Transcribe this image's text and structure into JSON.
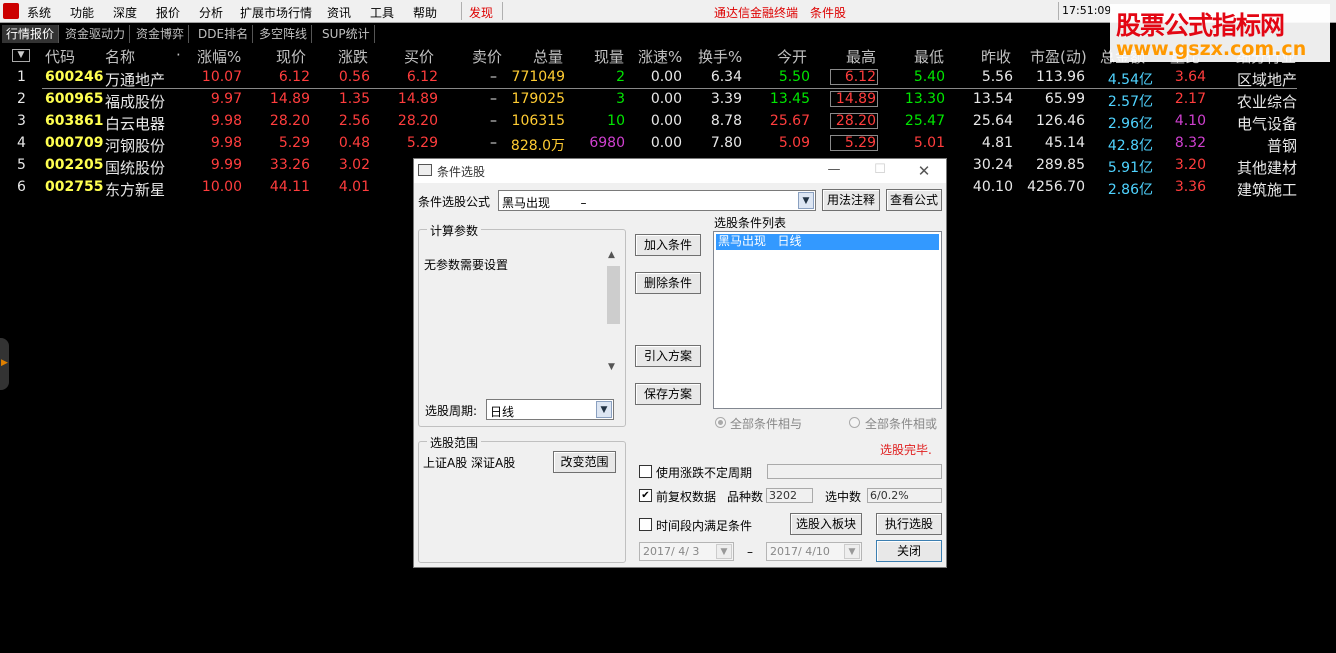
{
  "menu": {
    "items": [
      "系统",
      "功能",
      "深度",
      "报价",
      "分析",
      "扩展市场行情",
      "资讯",
      "工具",
      "帮助"
    ],
    "discover": "发现",
    "app_title": "通达信金融终端",
    "app_subtitle": "条件股",
    "clock": "17:51:09"
  },
  "watermark": {
    "line1": "股票公式指标网",
    "line2": "www.gszx.com.cn"
  },
  "tabs": [
    "行情报价",
    "资金驱动力",
    "资金博弈",
    "DDE排名",
    "多空阵线",
    "SUP统计"
  ],
  "columns": [
    "代码",
    "名称",
    "·",
    "涨幅%",
    "现价",
    "涨跌",
    "买价",
    "卖价",
    "总量",
    "现量",
    "涨速%",
    "换手%",
    "今开",
    "最高",
    "最低",
    "昨收",
    "市盈(动)",
    "总金额",
    "量比",
    "细分行业"
  ],
  "rows": [
    {
      "idx": "1",
      "code": "600246",
      "name": "万通地产",
      "chg_pct": "10.07",
      "price": "6.12",
      "chg": "0.56",
      "bid": "6.12",
      "ask": "–",
      "vol": "771049",
      "cur_vol": "2",
      "speed": "0.00",
      "turnover": "6.34",
      "open": "5.50",
      "high": "6.12",
      "low": "5.40",
      "prev": "5.56",
      "pe": "113.96",
      "amount": "4.54亿",
      "vol_ratio": "3.64",
      "industry": "区域地产"
    },
    {
      "idx": "2",
      "code": "600965",
      "name": "福成股份",
      "chg_pct": "9.97",
      "price": "14.89",
      "chg": "1.35",
      "bid": "14.89",
      "ask": "–",
      "vol": "179025",
      "cur_vol": "3",
      "speed": "0.00",
      "turnover": "3.39",
      "open": "13.45",
      "high": "14.89",
      "low": "13.30",
      "prev": "13.54",
      "pe": "65.99",
      "amount": "2.57亿",
      "vol_ratio": "2.17",
      "industry": "农业综合"
    },
    {
      "idx": "3",
      "code": "603861",
      "name": "白云电器",
      "chg_pct": "9.98",
      "price": "28.20",
      "chg": "2.56",
      "bid": "28.20",
      "ask": "–",
      "vol": "106315",
      "cur_vol": "10",
      "speed": "0.00",
      "turnover": "8.78",
      "open": "25.67",
      "high": "28.20",
      "low": "25.47",
      "prev": "25.64",
      "pe": "126.46",
      "amount": "2.96亿",
      "vol_ratio": "4.10",
      "industry": "电气设备"
    },
    {
      "idx": "4",
      "code": "000709",
      "name": "河钢股份",
      "chg_pct": "9.98",
      "price": "5.29",
      "chg": "0.48",
      "bid": "5.29",
      "ask": "–",
      "vol": "828.0万",
      "cur_vol": "6980",
      "speed": "0.00",
      "turnover": "7.80",
      "open": "5.09",
      "high": "5.29",
      "low": "5.01",
      "prev": "4.81",
      "pe": "45.14",
      "amount": "42.8亿",
      "vol_ratio": "8.32",
      "industry": "普钢"
    },
    {
      "idx": "5",
      "code": "002205",
      "name": "国统股份",
      "chg_pct": "9.99",
      "price": "33.26",
      "chg": "3.02",
      "bid": "33",
      "prev": "30.24",
      "pe": "289.85",
      "amount": "5.91亿",
      "vol_ratio": "3.20",
      "industry": "其他建材"
    },
    {
      "idx": "6",
      "code": "002755",
      "name": "东方新星",
      "chg_pct": "10.00",
      "price": "44.11",
      "chg": "4.01",
      "bid": "44",
      "prev": "40.10",
      "pe": "4256.70",
      "amount": "2.86亿",
      "vol_ratio": "3.36",
      "industry": "建筑施工"
    }
  ],
  "dialog": {
    "title": "条件选股",
    "formula_label": "条件选股公式",
    "formula_value": "黑马出现        –",
    "usage_btn": "用法注释",
    "view_formula_btn": "查看公式",
    "params_group": "计算参数",
    "params_text": "无参数需要设置",
    "period_label": "选股周期:",
    "period_value": "日线",
    "add_btn": "加入条件",
    "delete_btn": "删除条件",
    "import_btn": "引入方案",
    "save_btn": "保存方案",
    "cond_list_label": "选股条件列表",
    "cond_item": "黑马出现   日线",
    "and_label": "全部条件相与",
    "or_label": "全部条件相或",
    "status": "选股完毕.",
    "range_group": "选股范围",
    "range_text": "上证A股 深证A股",
    "change_range_btn": "改变范围",
    "var_period_label": "使用涨跌不定周期",
    "rights_label": "前复权数据",
    "count_label": "品种数",
    "count_value": "3202",
    "selected_label": "选中数",
    "selected_value": "6/0.2%",
    "timespan_label": "时间段内满足条件",
    "to_block_btn": "选股入板块",
    "execute_btn": "执行选股",
    "date_from": "2017/ 4/ 3",
    "date_sep": "–",
    "date_to": "2017/ 4/10",
    "close_btn": "关闭"
  },
  "colors": {
    "up": "#ff3d3d",
    "down": "#00e600",
    "code": "#ffff50",
    "amount": "#4fd3ff"
  }
}
